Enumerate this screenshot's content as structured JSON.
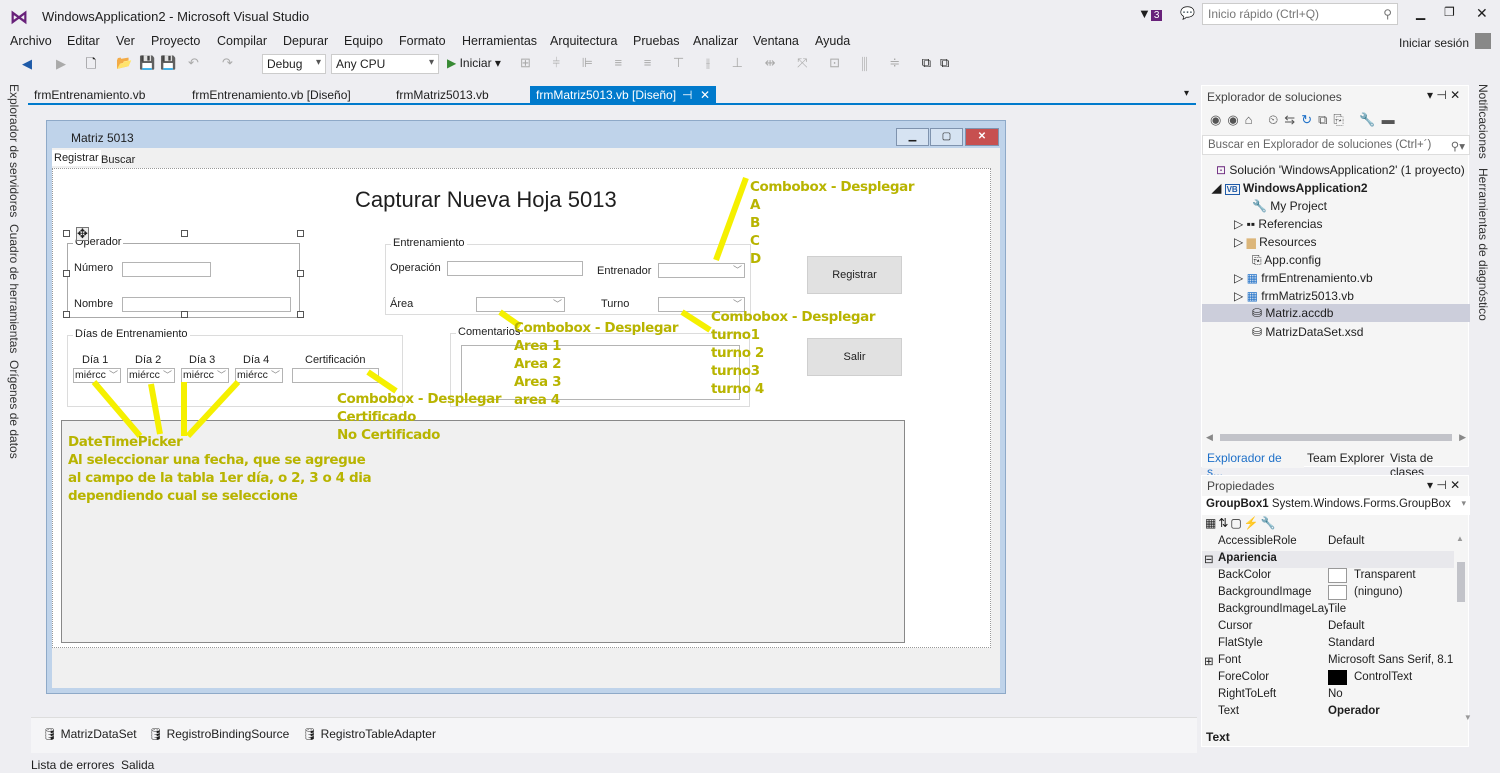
{
  "window": {
    "title": "WindowsApplication2 - Microsoft Visual Studio",
    "notif_count": "3",
    "quick_launch_placeholder": "Inicio rápido (Ctrl+Q)",
    "sign_in": "Iniciar sesión"
  },
  "menu": [
    "Archivo",
    "Editar",
    "Ver",
    "Proyecto",
    "Compilar",
    "Depurar",
    "Equipo",
    "Formato",
    "Herramientas",
    "Arquitectura",
    "Pruebas",
    "Analizar",
    "Ventana",
    "Ayuda"
  ],
  "toolbar": {
    "config": "Debug",
    "platform": "Any CPU",
    "start": "Iniciar"
  },
  "left_strip": [
    "Explorador de servidores",
    "Cuadro de herramientas",
    "Orígenes de datos"
  ],
  "right_strip": [
    "Notificaciones",
    "Herramientas de diagnóstico"
  ],
  "doc_tabs": [
    {
      "label": "frmEntrenamiento.vb"
    },
    {
      "label": "frmEntrenamiento.vb [Diseño]"
    },
    {
      "label": "frmMatriz5013.vb"
    },
    {
      "label": "frmMatriz5013.vb [Diseño]",
      "active": true
    }
  ],
  "form": {
    "title": "Matriz 5013",
    "tabs": [
      "Registrar",
      "Buscar"
    ],
    "heading": "Capturar Nueva Hoja 5013",
    "operador": {
      "title": "Operador",
      "numero": "Número",
      "nombre": "Nombre"
    },
    "entrenamiento": {
      "title": "Entrenamiento",
      "operacion": "Operación",
      "entrenador": "Entrenador",
      "area": "Área",
      "turno": "Turno"
    },
    "dias": {
      "title": "Días de Entrenamiento",
      "labels": [
        "Día 1",
        "Día 2",
        "Día 3",
        "Día 4"
      ],
      "values": [
        "miércc",
        "miércc",
        "miércc",
        "miércc"
      ],
      "certificacion": "Certificación"
    },
    "comentarios": "Comentarios",
    "registrar": "Registrar",
    "salir": "Salir"
  },
  "annotations": {
    "entrenador": "Combobox - Desplegar\nA\nB\nC\nD",
    "area": "Combobox - Desplegar\nArea 1\nArea 2\nArea 3\narea 4",
    "turno": "Combobox - Desplegar\nturno1\nturno 2\nturno3\nturno 4",
    "certificacion": "Combobox - Desplegar\nCertificado\nNo Certificado",
    "datetime": "DateTimePicker\nAl seleccionar una fecha, que se agregue\nal campo de la tabla 1er día, o 2, 3 o 4 dia\ndependiendo cual se seleccione",
    "color": "#f5f000"
  },
  "tray": [
    "MatrizDataSet",
    "RegistroBindingSource",
    "RegistroTableAdapter"
  ],
  "bottom_tabs": [
    "Lista de errores",
    "Salida"
  ],
  "solution_explorer": {
    "title": "Explorador de soluciones",
    "search_placeholder": "Buscar en Explorador de soluciones (Ctrl+´)",
    "items": [
      "Solución 'WindowsApplication2'  (1 proyecto)",
      "WindowsApplication2",
      "My Project",
      "Referencias",
      "Resources",
      "App.config",
      "frmEntrenamiento.vb",
      "frmMatriz5013.vb",
      "Matriz.accdb",
      "MatrizDataSet.xsd"
    ],
    "selected": "Matriz.accdb",
    "tabs": [
      "Explorador de s...",
      "Team Explorer",
      "Vista de clases"
    ]
  },
  "properties": {
    "title": "Propiedades",
    "object": "GroupBox1",
    "type": "System.Windows.Forms.GroupBox",
    "rows": [
      [
        "AccessibleRole",
        "Default"
      ],
      [
        "Apariencia",
        ""
      ],
      [
        "BackColor",
        "Transparent"
      ],
      [
        "BackgroundImage",
        "(ninguno)"
      ],
      [
        "BackgroundImageLay",
        "Tile"
      ],
      [
        "Cursor",
        "Default"
      ],
      [
        "FlatStyle",
        "Standard"
      ],
      [
        "Font",
        "Microsoft Sans Serif, 8.1"
      ],
      [
        "ForeColor",
        "ControlText"
      ],
      [
        "RightToLeft",
        "No"
      ],
      [
        "Text",
        "Operador"
      ]
    ],
    "description": "Text"
  }
}
